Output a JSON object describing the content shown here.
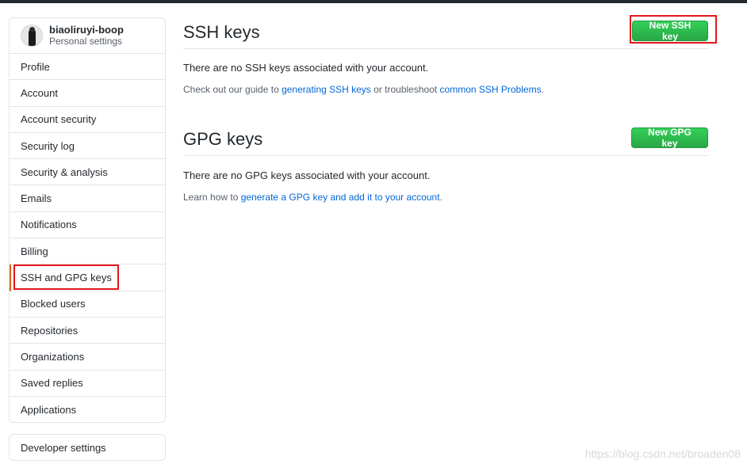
{
  "user": {
    "name": "biaoliruyi-boop",
    "subtitle": "Personal settings"
  },
  "sidebar": {
    "items": [
      {
        "label": "Profile"
      },
      {
        "label": "Account"
      },
      {
        "label": "Account security"
      },
      {
        "label": "Security log"
      },
      {
        "label": "Security & analysis"
      },
      {
        "label": "Emails"
      },
      {
        "label": "Notifications"
      },
      {
        "label": "Billing"
      },
      {
        "label": "SSH and GPG keys",
        "selected": true
      },
      {
        "label": "Blocked users"
      },
      {
        "label": "Repositories"
      },
      {
        "label": "Organizations"
      },
      {
        "label": "Saved replies"
      },
      {
        "label": "Applications"
      }
    ],
    "developer_settings": "Developer settings"
  },
  "ssh": {
    "title": "SSH keys",
    "button": "New SSH key",
    "empty_text": "There are no SSH keys associated with your account.",
    "guide_prefix": "Check out our guide to ",
    "guide_link": "generating SSH keys",
    "guide_mid": " or troubleshoot ",
    "guide_link2": "common SSH Problems",
    "guide_suffix": "."
  },
  "gpg": {
    "title": "GPG keys",
    "button": "New GPG key",
    "empty_text": "There are no GPG keys associated with your account.",
    "learn_prefix": "Learn how to ",
    "learn_link": "generate a GPG key and add it to your account",
    "learn_suffix": "."
  },
  "watermark": "https://blog.csdn.net/broaden08",
  "colors": {
    "accent_green": "#2ea44f",
    "link_blue": "#0366d6",
    "selected_bar": "#e36209",
    "annotation_red": "#e3161c"
  }
}
